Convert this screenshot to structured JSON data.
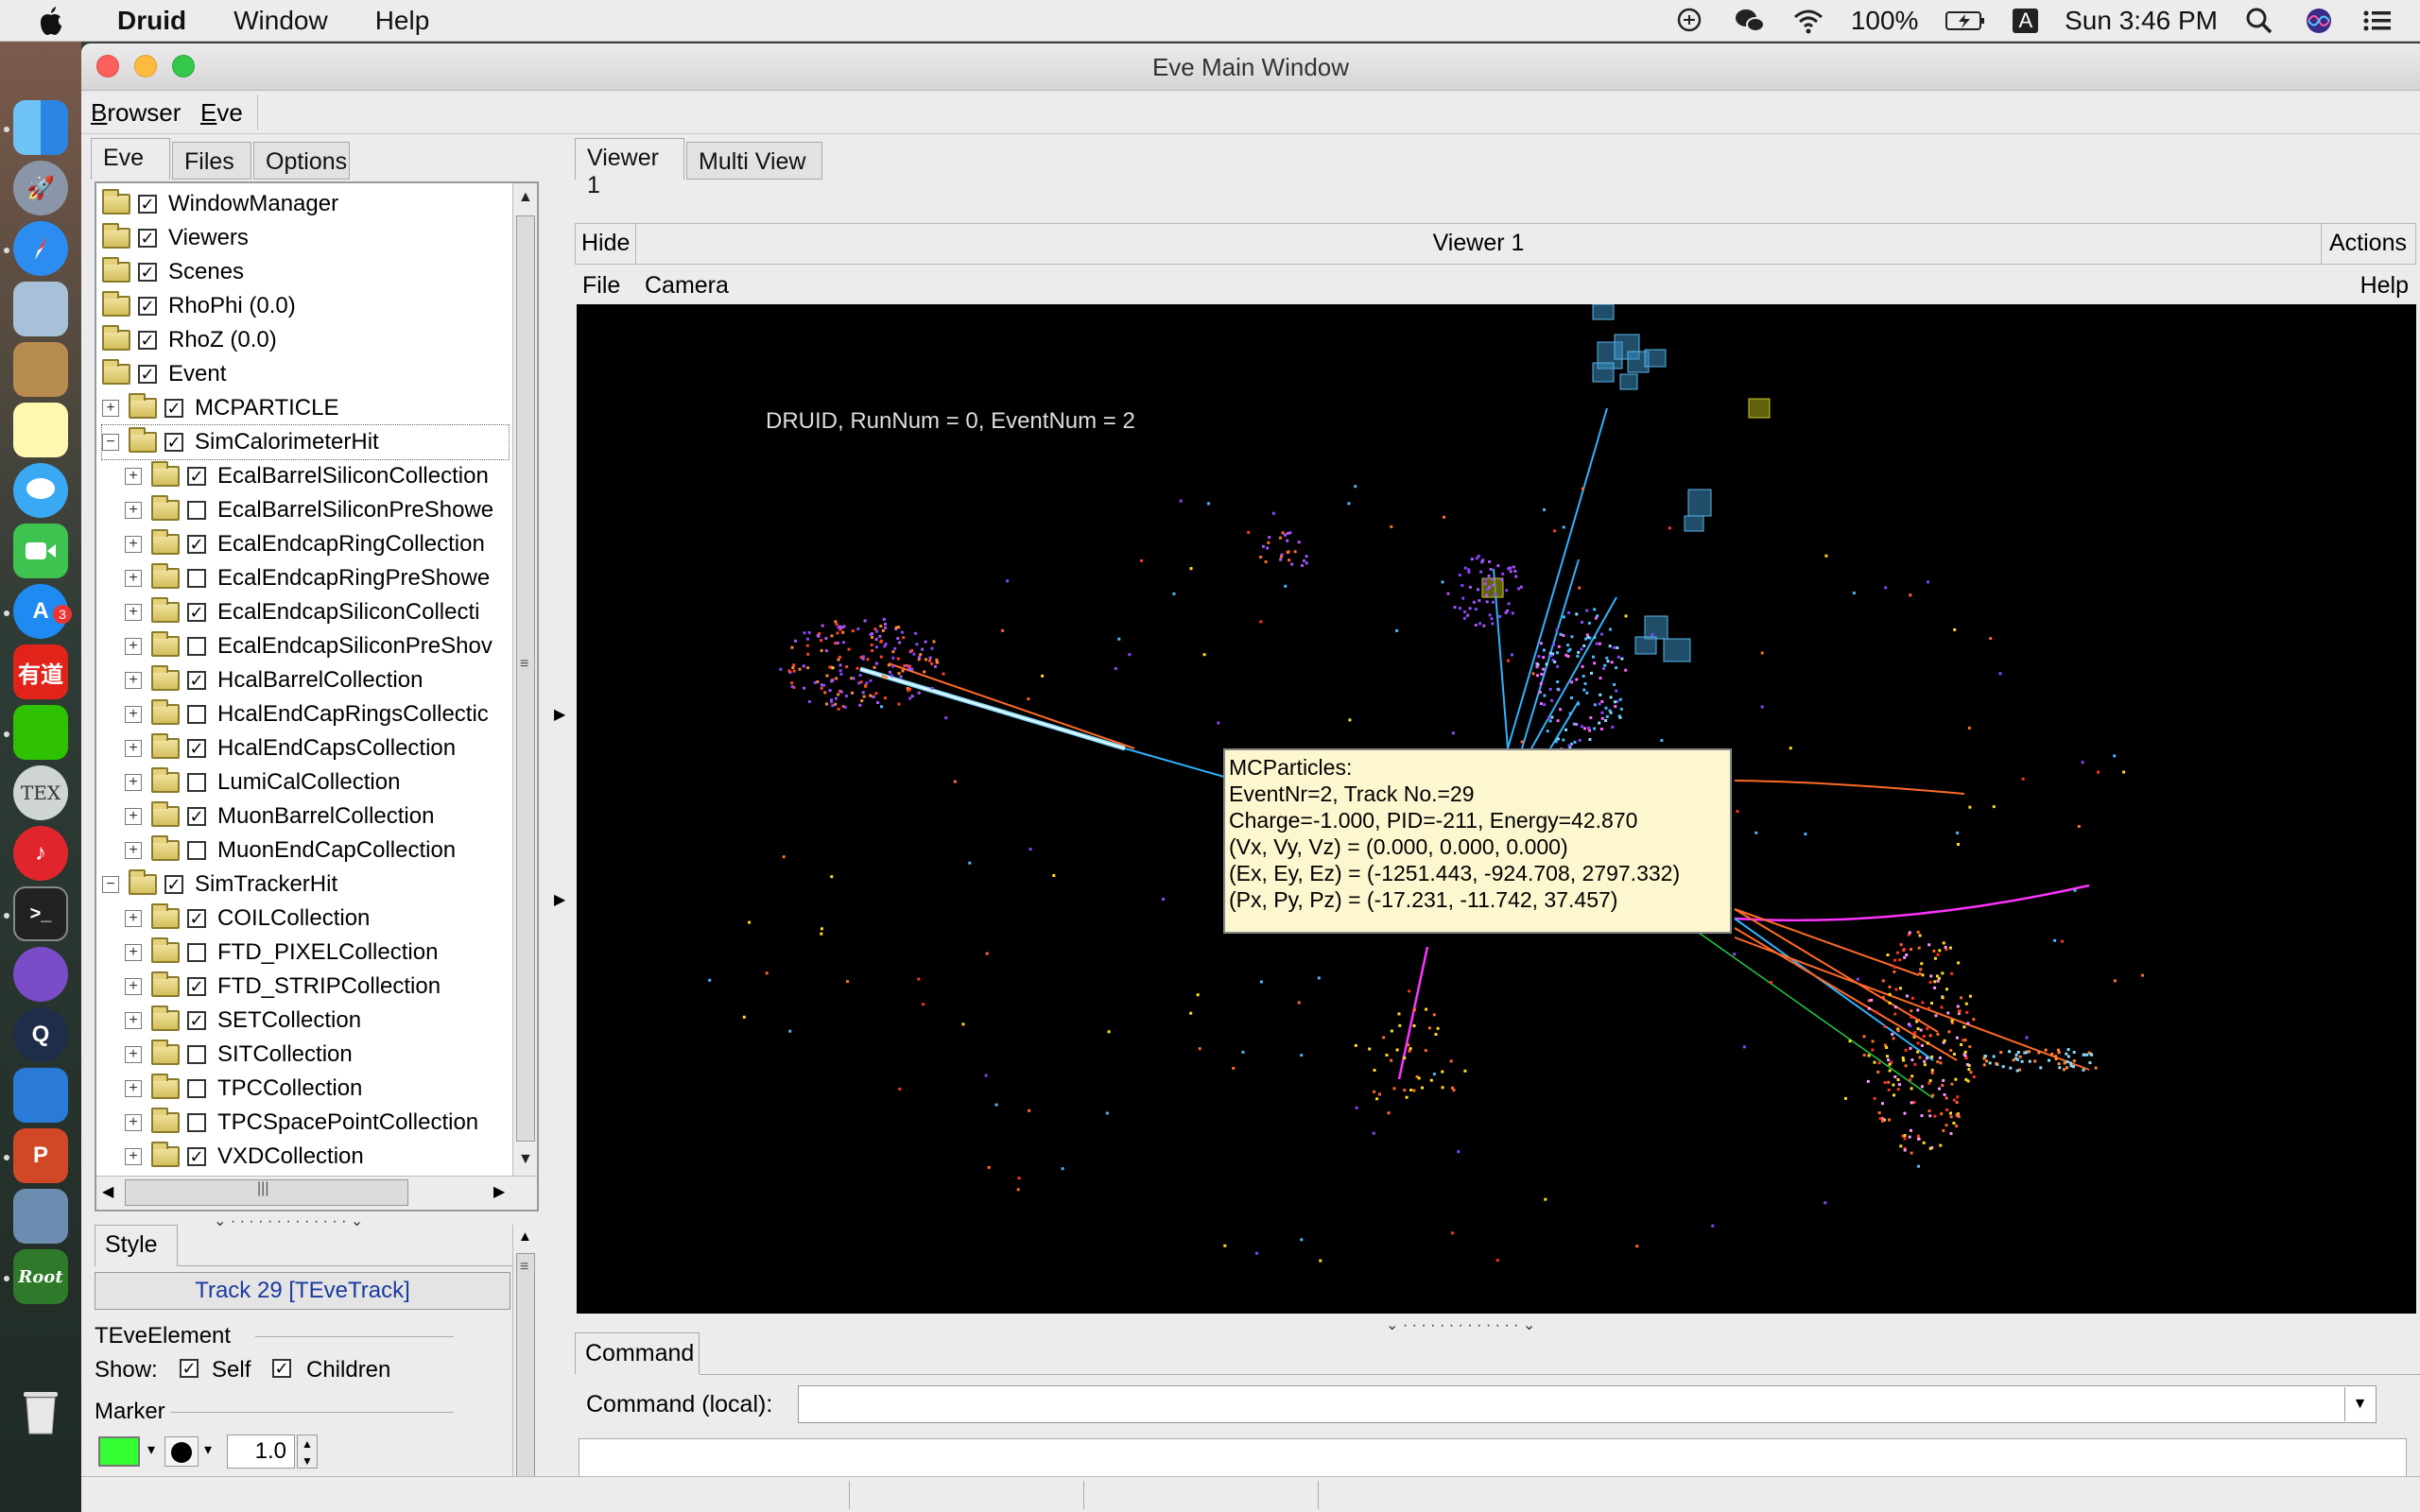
{
  "menubar": {
    "app_name": "Druid",
    "menus": [
      "Window",
      "Help"
    ],
    "battery": "100%",
    "keyboard": "A",
    "clock": "Sun 3:46 PM",
    "icons": [
      "apple-icon",
      "input-icon",
      "wechat-icon",
      "wifi-icon",
      "battery-icon",
      "keyboard-icon",
      "search-icon",
      "siri-icon",
      "list-icon"
    ]
  },
  "dock": {
    "items": [
      "finder",
      "launchpad",
      "safari",
      "preview",
      "notes-app",
      "stickies",
      "messages",
      "facetime",
      "app-store",
      "youdao",
      "wechat",
      "tex",
      "netease-music",
      "terminal",
      "github",
      "quicktime",
      "xcode",
      "powerpoint",
      "image-capture",
      "root",
      "trash"
    ],
    "app_store_badge": "3",
    "youdao_label": "有道",
    "tex_label": "TEX",
    "root_label": "Root"
  },
  "window": {
    "title": "Eve Main Window",
    "menu": [
      "Browser",
      "Eve"
    ]
  },
  "left_tabs": [
    "Eve",
    "Files",
    "Options"
  ],
  "tree": [
    {
      "indent": 0,
      "exp": "",
      "checked": true,
      "label": "WindowManager"
    },
    {
      "indent": 0,
      "exp": "",
      "checked": true,
      "label": "Viewers"
    },
    {
      "indent": 0,
      "exp": "",
      "checked": true,
      "label": "Scenes"
    },
    {
      "indent": 0,
      "exp": "",
      "checked": true,
      "label": "RhoPhi (0.0)"
    },
    {
      "indent": 0,
      "exp": "",
      "checked": true,
      "label": "RhoZ (0.0)"
    },
    {
      "indent": 0,
      "exp": "open",
      "checked": true,
      "label": "Event"
    },
    {
      "indent": 1,
      "exp": "+",
      "checked": true,
      "label": "MCPARTICLE"
    },
    {
      "indent": 1,
      "exp": "-",
      "checked": true,
      "label": "SimCalorimeterHit",
      "open": true
    },
    {
      "indent": 2,
      "exp": "+",
      "checked": true,
      "label": "EcalBarrelSiliconCollection"
    },
    {
      "indent": 2,
      "exp": "+",
      "checked": false,
      "label": "EcalBarrelSiliconPreShowe"
    },
    {
      "indent": 2,
      "exp": "+",
      "checked": true,
      "label": "EcalEndcapRingCollection"
    },
    {
      "indent": 2,
      "exp": "+",
      "checked": false,
      "label": "EcalEndcapRingPreShowe"
    },
    {
      "indent": 2,
      "exp": "+",
      "checked": true,
      "label": "EcalEndcapSiliconCollecti"
    },
    {
      "indent": 2,
      "exp": "+",
      "checked": false,
      "label": "EcalEndcapSiliconPreShov"
    },
    {
      "indent": 2,
      "exp": "+",
      "checked": true,
      "label": "HcalBarrelCollection"
    },
    {
      "indent": 2,
      "exp": "+",
      "checked": false,
      "label": "HcalEndCapRingsCollectic"
    },
    {
      "indent": 2,
      "exp": "+",
      "checked": true,
      "label": "HcalEndCapsCollection"
    },
    {
      "indent": 2,
      "exp": "+",
      "checked": false,
      "label": "LumiCalCollection"
    },
    {
      "indent": 2,
      "exp": "+",
      "checked": true,
      "label": "MuonBarrelCollection"
    },
    {
      "indent": 2,
      "exp": "+",
      "checked": false,
      "label": "MuonEndCapCollection"
    },
    {
      "indent": 1,
      "exp": "-",
      "checked": true,
      "label": "SimTrackerHit",
      "open": true
    },
    {
      "indent": 2,
      "exp": "+",
      "checked": true,
      "label": "COILCollection"
    },
    {
      "indent": 2,
      "exp": "+",
      "checked": false,
      "label": "FTD_PIXELCollection"
    },
    {
      "indent": 2,
      "exp": "+",
      "checked": true,
      "label": "FTD_STRIPCollection"
    },
    {
      "indent": 2,
      "exp": "+",
      "checked": true,
      "label": "SETCollection"
    },
    {
      "indent": 2,
      "exp": "+",
      "checked": false,
      "label": "SITCollection"
    },
    {
      "indent": 2,
      "exp": "+",
      "checked": false,
      "label": "TPCCollection"
    },
    {
      "indent": 2,
      "exp": "+",
      "checked": false,
      "label": "TPCSpacePointCollection"
    },
    {
      "indent": 2,
      "exp": "+",
      "checked": true,
      "label": "VXDCollection"
    }
  ],
  "editor": {
    "tab": "Style",
    "object_button": "Track 29 [TEveTrack]",
    "section": "TEveElement",
    "show_label": "Show:",
    "self_label": "Self",
    "children_label": "Children",
    "marker_label": "Marker",
    "marker_size": "1.0",
    "marker_color": "#33ff33"
  },
  "viewer": {
    "tabs": [
      "Viewer 1",
      "Multi View"
    ],
    "hide_button": "Hide",
    "header_title": "Viewer 1",
    "actions_button": "Actions",
    "menu": [
      "File",
      "Camera"
    ],
    "help": "Help",
    "event_label": "DRUID, RunNum = 0, EventNum = 2",
    "tooltip": [
      "MCParticles:",
      "EventNr=2, Track No.=29",
      "Charge=-1.000, PID=-211, Energy=42.870",
      "(Vx, Vy, Vz) = (0.000, 0.000, 0.000)",
      "(Ex, Ey, Ez) = (-1251.443, -924.708, 2797.332)",
      "(Px, Py, Pz) = (-17.231, -11.742, 37.457)"
    ]
  },
  "command": {
    "tab": "Command",
    "label": "Command (local):",
    "value": ""
  }
}
